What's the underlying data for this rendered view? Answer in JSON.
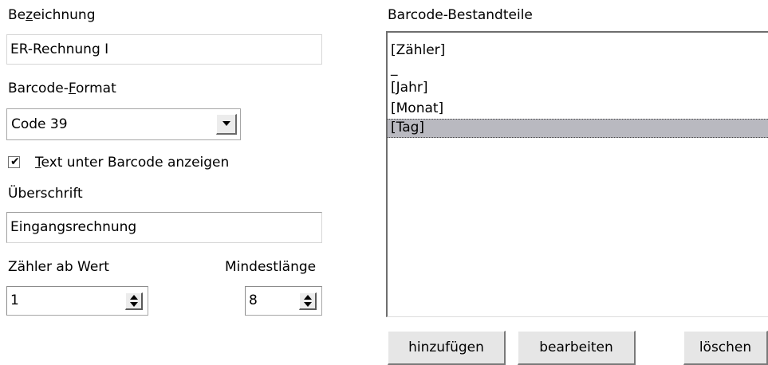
{
  "left": {
    "bezeichnung": {
      "label_pre": "Be",
      "label_key": "z",
      "label_post": "eichnung",
      "value": "ER-Rechnung I"
    },
    "barcode_format": {
      "label_pre": "Barcode-",
      "label_key": "F",
      "label_post": "ormat",
      "selected": "Code 39"
    },
    "text_checkbox": {
      "checked": true,
      "mark": "✔",
      "label_key": "T",
      "label_post": "ext unter Barcode anzeigen"
    },
    "ueberschrift": {
      "label": "Überschrift",
      "value": "Eingangsrechnung"
    },
    "zaehler": {
      "label": "Zähler ab Wert",
      "value": "1"
    },
    "mindestlaenge": {
      "label": "Mindestlänge",
      "value": "8"
    }
  },
  "right": {
    "label": "Barcode-Bestandteile",
    "items": [
      "[Zähler]",
      "_",
      "[Jahr]",
      "[Monat]",
      "[Tag]"
    ],
    "selected_index": 4,
    "buttons": {
      "add": "hinzufügen",
      "edit": "bearbeiten",
      "delete": "löschen"
    }
  }
}
